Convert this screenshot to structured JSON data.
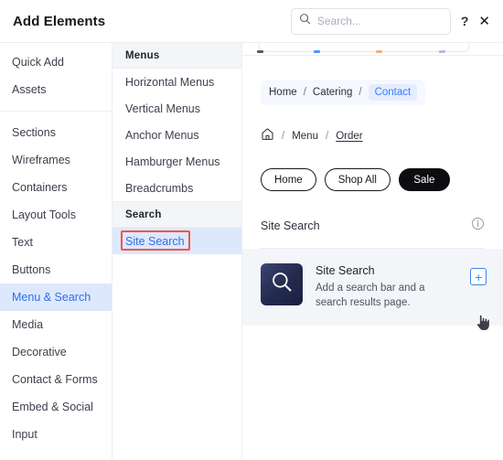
{
  "header": {
    "title": "Add Elements",
    "search_placeholder": "Search...",
    "help_label": "?",
    "close_label": "✕"
  },
  "sidebar": {
    "groups": [
      {
        "items": [
          {
            "label": "Quick Add",
            "active": false
          },
          {
            "label": "Assets",
            "active": false
          }
        ]
      },
      {
        "items": [
          {
            "label": "Sections",
            "active": false
          },
          {
            "label": "Wireframes",
            "active": false
          },
          {
            "label": "Containers",
            "active": false
          },
          {
            "label": "Layout Tools",
            "active": false
          },
          {
            "label": "Text",
            "active": false
          },
          {
            "label": "Buttons",
            "active": false
          },
          {
            "label": "Menu & Search",
            "active": true
          },
          {
            "label": "Media",
            "active": false
          },
          {
            "label": "Decorative",
            "active": false
          },
          {
            "label": "Contact & Forms",
            "active": false
          },
          {
            "label": "Embed & Social",
            "active": false
          },
          {
            "label": "Input",
            "active": false
          }
        ]
      }
    ]
  },
  "middle": {
    "sections": [
      {
        "header": "Menus",
        "items": [
          {
            "label": "Horizontal Menus",
            "selected": false,
            "annotated": false
          },
          {
            "label": "Vertical Menus",
            "selected": false,
            "annotated": false
          },
          {
            "label": "Anchor Menus",
            "selected": false,
            "annotated": false
          },
          {
            "label": "Hamburger Menus",
            "selected": false,
            "annotated": false
          },
          {
            "label": "Breadcrumbs",
            "selected": false,
            "annotated": false
          }
        ]
      },
      {
        "header": "Search",
        "items": [
          {
            "label": "Site Search",
            "selected": true,
            "annotated": true
          }
        ]
      }
    ]
  },
  "preview": {
    "breadcrumb_pill": {
      "items": [
        "Home",
        "Catering",
        "Contact"
      ],
      "separator": "/",
      "active_index": 2
    },
    "breadcrumb_simple": {
      "home_icon": "home-icon",
      "items": [
        "Menu",
        "Order"
      ],
      "separator": "/",
      "underlined_index": 1
    },
    "buttons": [
      {
        "label": "Home",
        "style": "outline"
      },
      {
        "label": "Shop All",
        "style": "outline"
      },
      {
        "label": "Sale",
        "style": "solid"
      }
    ],
    "section": {
      "title": "Site Search",
      "info_icon": "info-icon"
    },
    "card": {
      "icon": "magnifier-icon",
      "title": "Site Search",
      "description": "Add a search bar and a search results page.",
      "add_label": "+"
    },
    "clipped_dots": [
      "#3c3f47",
      "#3b82f6",
      "#f0a36b",
      "#b9a6e8"
    ]
  },
  "colors": {
    "accent_blue": "#3b82f6",
    "selected_bg": "#dde8fd",
    "annotation_red": "#f4553d",
    "card_bg": "#f3f5f9",
    "tile_navy": "#232a4d"
  }
}
